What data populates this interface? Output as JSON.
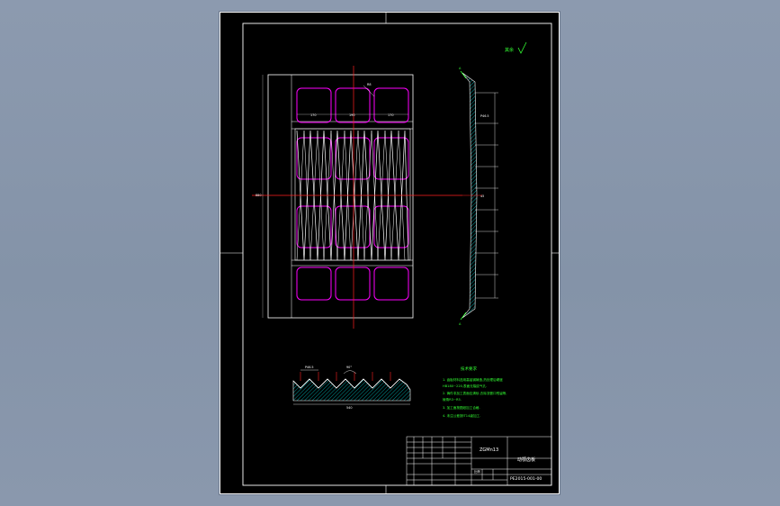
{
  "drawing": {
    "roughness_mark": "其余",
    "tech_requirements_title": "技术要求",
    "tech_requirements": [
      "1. 齿板材料选用高锰钢铸造,热处理后硬度",
      "HB180~220,表面无裂纹气孔.",
      "2. 铸件非加工表面应清砂,去除浇冒口残留等,",
      "棱角R3~R5.",
      "3. 加工面按图纸加工合格.",
      "4. 未注公差按IT14级加工."
    ],
    "title_block": {
      "material": "ZGMn13",
      "part_name": "动颚齿板",
      "drawing_number": "PE2015-001-00",
      "scale_label": "比例"
    },
    "dimension_labels": {
      "width_left": "170",
      "width_mid": "190",
      "width_right": "170",
      "height": "880",
      "radius": "R8",
      "pitch": "P46.5",
      "angle": "90°",
      "overall_width": "540",
      "side_thickness": "45"
    }
  },
  "colors": {
    "outline": "#ffffff",
    "pockets": "#ff00ff",
    "centerline": "#ff2020",
    "hatch": "#00cccc",
    "annotation": "#33ff33"
  }
}
